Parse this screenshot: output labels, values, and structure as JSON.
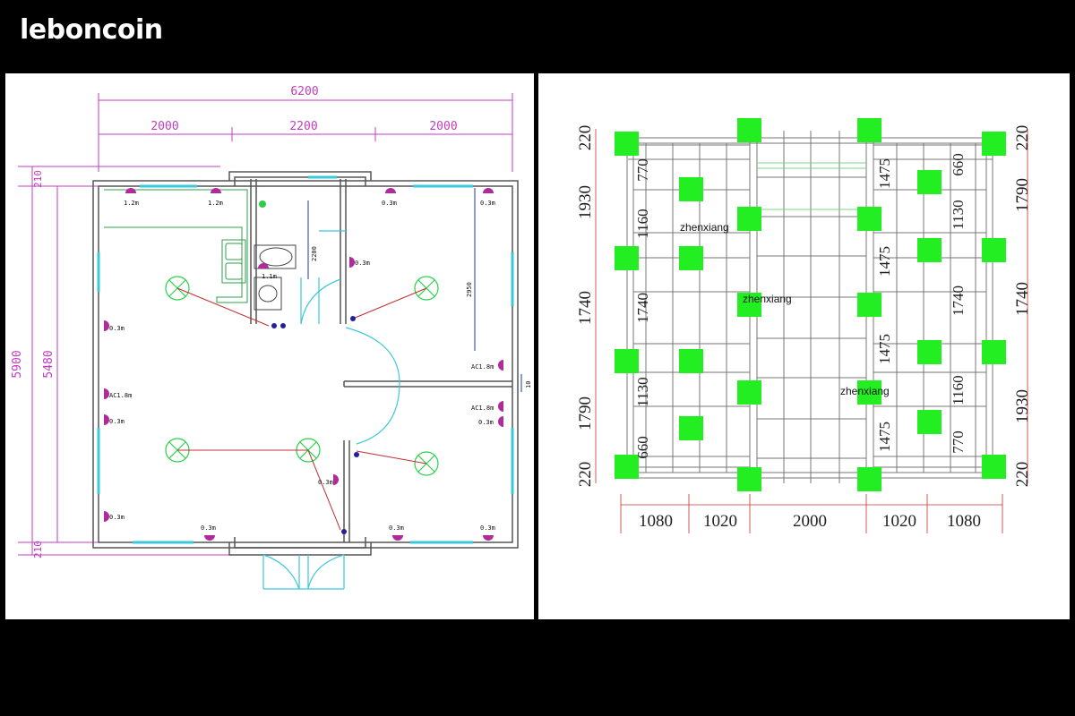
{
  "logo": "leboncoin",
  "floor_plan": {
    "dims": {
      "total_width": "6200",
      "seg_left": "2000",
      "seg_mid": "2200",
      "seg_right": "2000",
      "outer_height": "5900",
      "inner_height": "5480",
      "top_margin": "210",
      "bottom_margin": "210",
      "bath_depth": "2200",
      "bed_depth": "2950",
      "door_gap": "10"
    },
    "sockets": {
      "s12a": "1.2m",
      "s12b": "1.2m",
      "s03_tr1": "0.3m",
      "s03_tr2": "0.3m",
      "s03_room": "0.3m",
      "s11": "1.1m",
      "s03_l1": "0.3m",
      "ac_left": "AC1.8m",
      "s03_l2": "0.3m",
      "s03_l3": "0.3m",
      "ac_r1": "AC1.8m",
      "ac_r2": "AC1.8m",
      "s03_r1": "0.3m",
      "s03_mid": "0.3m",
      "s03_b1": "0.3m",
      "s03_b2": "0.3m",
      "s03_b3": "0.3m"
    }
  },
  "structure_plan": {
    "left_dims": [
      "220",
      "1930",
      "1740",
      "1790",
      "220"
    ],
    "right_dims": [
      "220",
      "1790",
      "1740",
      "1930",
      "220"
    ],
    "left_inner": [
      "770",
      "1160",
      "1740",
      "1130",
      "660"
    ],
    "right_inner": [
      "660",
      "1130",
      "1740",
      "1160",
      "770"
    ],
    "mid_left": [
      "1475",
      "1475",
      "1475",
      "1475"
    ],
    "bottom_dims": [
      "1080",
      "1020",
      "2000",
      "1020",
      "1080"
    ],
    "labels": [
      "zhenxiang",
      "zhenxiang",
      "zhenxiang"
    ]
  }
}
